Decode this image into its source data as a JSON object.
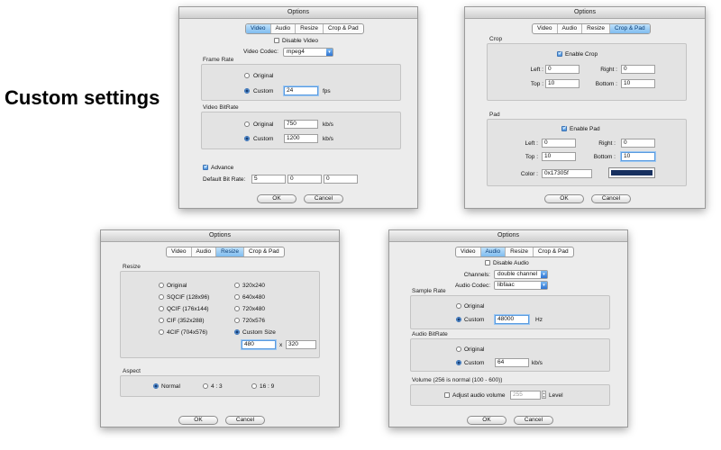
{
  "heading": "Custom settings",
  "tabs": [
    "Video",
    "Audio",
    "Resize",
    "Crop & Pad"
  ],
  "video": {
    "title": "Options",
    "disable_video": "Disable Video",
    "codec_label": "Video Codec:",
    "codec_value": "mpeg4",
    "frame_rate_group": "Frame Rate",
    "original": "Original",
    "custom": "Custom",
    "fps_value": "24",
    "fps_unit": "fps",
    "bitrate_group": "Video BitRate",
    "bitrate_original": "750",
    "bitrate_custom": "1200",
    "kbs": "kb/s",
    "advance": "Advance",
    "default_bitrate_label": "Default Bit Rate:",
    "adv_values": [
      "5",
      "0",
      "0"
    ],
    "ok": "OK",
    "cancel": "Cancel"
  },
  "crop": {
    "title": "Options",
    "crop_group": "Crop",
    "enable_crop": "Enable Crop",
    "left_label": "Left :",
    "left": "0",
    "right_label": "Right :",
    "right": "0",
    "top_label": "Top :",
    "top": "10",
    "bottom_label": "Bottom :",
    "bottom": "10",
    "pad_group": "Pad",
    "enable_pad": "Enable Pad",
    "pad_left": "0",
    "pad_right": "0",
    "pad_top": "10",
    "pad_bottom": "10",
    "color_label": "Color :",
    "color_value": "0x17305f",
    "color_hex": "#17305f",
    "ok": "OK",
    "cancel": "Cancel"
  },
  "resize": {
    "title": "Options",
    "group": "Resize",
    "options_left": [
      "Original",
      "SQCIF (128x96)",
      "QCIF (176x144)",
      "CIF (352x288)",
      "4CIF (704x576)"
    ],
    "options_right": [
      "320x240",
      "640x480",
      "720x480",
      "720x576",
      "Custom Size"
    ],
    "width": "480",
    "x": "x",
    "height": "320",
    "aspect_group": "Aspect",
    "aspect_normal": "Normal",
    "aspect_43": "4 : 3",
    "aspect_169": "16 : 9",
    "ok": "OK",
    "cancel": "Cancel"
  },
  "audio": {
    "title": "Options",
    "disable_audio": "Disable Audio",
    "channels_label": "Channels:",
    "channels_value": "double channel",
    "codec_label": "Audio Codec:",
    "codec_value": "libfaac",
    "sample_group": "Sample Rate",
    "original": "Original",
    "custom": "Custom",
    "sample_value": "48000",
    "hz": "Hz",
    "bitrate_group": "Audio BitRate",
    "bitrate_value": "64",
    "kbs": "kb/s",
    "volume_group": "Volume (256 is normal (100 - 600))",
    "adjust_volume": "Adjust audio volume",
    "volume_value": "255",
    "level": "Level",
    "ok": "OK",
    "cancel": "Cancel"
  }
}
